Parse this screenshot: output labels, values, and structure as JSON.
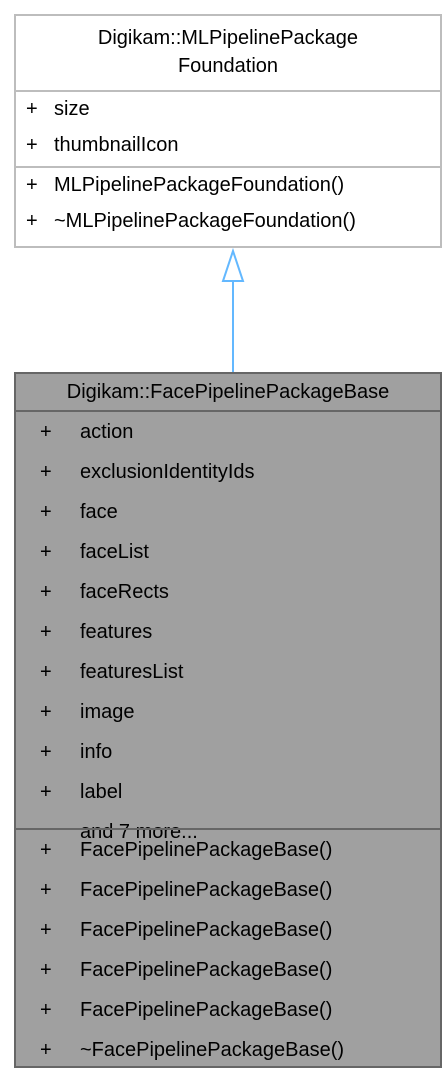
{
  "base_class": {
    "title_lines": [
      "Digikam::MLPipelinePackage",
      "Foundation"
    ],
    "attributes": [
      {
        "visibility": "+",
        "name": "size"
      },
      {
        "visibility": "+",
        "name": "thumbnailIcon"
      }
    ],
    "methods": [
      {
        "visibility": "+",
        "name": "MLPipelinePackageFoundation()"
      },
      {
        "visibility": "+",
        "name": "~MLPipelinePackageFoundation()"
      }
    ]
  },
  "derived_class": {
    "title": "Digikam::FacePipelinePackageBase",
    "attributes": [
      {
        "visibility": "+",
        "name": "action"
      },
      {
        "visibility": "+",
        "name": "exclusionIdentityIds"
      },
      {
        "visibility": "+",
        "name": "face"
      },
      {
        "visibility": "+",
        "name": "faceList"
      },
      {
        "visibility": "+",
        "name": "faceRects"
      },
      {
        "visibility": "+",
        "name": "features"
      },
      {
        "visibility": "+",
        "name": "featuresList"
      },
      {
        "visibility": "+",
        "name": "image"
      },
      {
        "visibility": "+",
        "name": "info"
      },
      {
        "visibility": "+",
        "name": "label"
      }
    ],
    "more_text": "and 7 more...",
    "methods": [
      {
        "visibility": "+",
        "name": "FacePipelinePackageBase()"
      },
      {
        "visibility": "+",
        "name": "FacePipelinePackageBase()"
      },
      {
        "visibility": "+",
        "name": "FacePipelinePackageBase()"
      },
      {
        "visibility": "+",
        "name": "FacePipelinePackageBase()"
      },
      {
        "visibility": "+",
        "name": "FacePipelinePackageBase()"
      },
      {
        "visibility": "+",
        "name": "~FacePipelinePackageBase()"
      }
    ]
  },
  "colors": {
    "base_fill": "#ffffff",
    "base_border": "#bdbdbd",
    "derived_fill": "#a0a0a0",
    "derived_border": "#666666",
    "inheritance_arrow": "#63b8ff"
  }
}
